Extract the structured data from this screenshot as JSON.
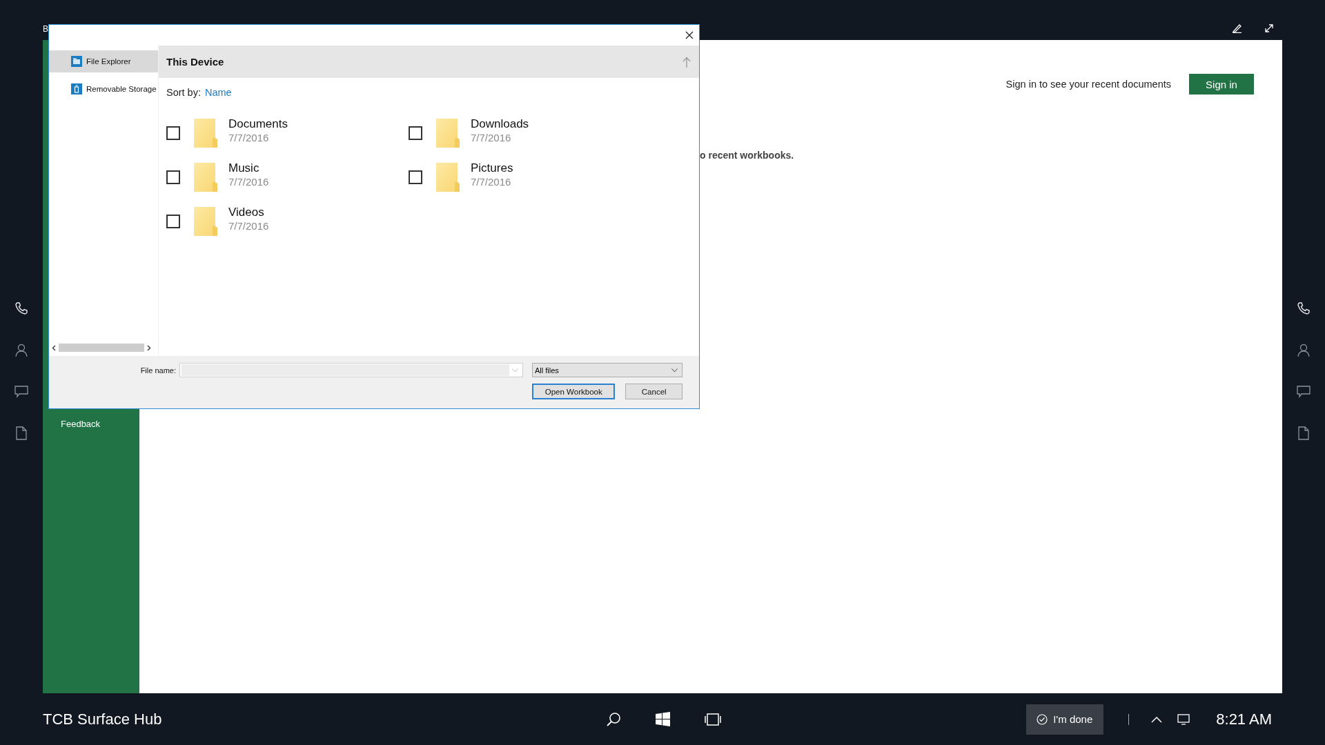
{
  "app": {
    "title_fragment": "B",
    "feedback": "Feedback",
    "sign_in_prompt": "Sign in to see your recent documents",
    "sign_in_button": "Sign in",
    "empty_message": "o recent workbooks."
  },
  "dialog": {
    "nav": [
      {
        "label": "File Explorer",
        "kind": "explorer",
        "selected": true
      },
      {
        "label": "Removable Storage",
        "kind": "storage",
        "selected": false
      }
    ],
    "location": "This Device",
    "sort_label": "Sort by:",
    "sort_value": "Name",
    "items": [
      {
        "name": "Documents",
        "date": "7/7/2016",
        "checked": false
      },
      {
        "name": "Downloads",
        "date": "7/7/2016",
        "checked": false
      },
      {
        "name": "Music",
        "date": "7/7/2016",
        "checked": false
      },
      {
        "name": "Pictures",
        "date": "7/7/2016",
        "checked": false
      },
      {
        "name": "Videos",
        "date": "7/7/2016",
        "checked": false
      }
    ],
    "file_name_label": "File name:",
    "file_type": "All files",
    "buttons": [
      {
        "label": "Open Workbook",
        "default": true
      },
      {
        "label": "Cancel",
        "default": false
      }
    ]
  },
  "taskbar": {
    "device_name": "TCB Surface Hub",
    "done_button": "I'm done",
    "time": "8:21 AM"
  }
}
